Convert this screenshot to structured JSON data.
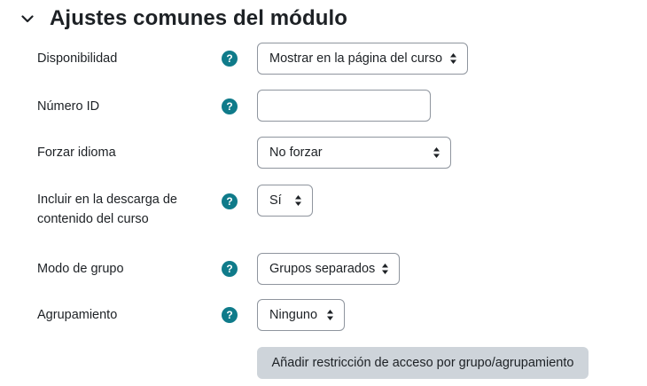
{
  "section": {
    "title": "Ajustes comunes del módulo",
    "icon": "chevron-down-icon"
  },
  "fields": {
    "availability": {
      "label": "Disponibilidad",
      "value": "Mostrar en la página del curso"
    },
    "id_number": {
      "label": "Número ID",
      "value": ""
    },
    "force_language": {
      "label": "Forzar idioma",
      "value": "No forzar"
    },
    "include_download": {
      "label_line1": "Incluir en la descarga de",
      "label_line2": "contenido del curso",
      "value": "Sí"
    },
    "group_mode": {
      "label": "Modo de grupo",
      "value": "Grupos separados"
    },
    "grouping": {
      "label": "Agrupamiento",
      "value": "Ninguno"
    }
  },
  "help_icon_glyph": "?",
  "buttons": {
    "add_restriction": "Añadir restricción de acceso por grupo/agrupamiento"
  },
  "colors": {
    "help_icon": "#0f7b8a",
    "button_bg": "#ced4da",
    "border": "#8f959e"
  }
}
